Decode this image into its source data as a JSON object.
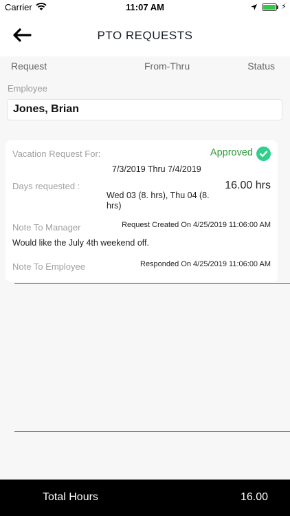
{
  "status_bar": {
    "carrier": "Carrier",
    "time": "11:07 AM",
    "icons": [
      "wifi-icon",
      "location-arrow-icon",
      "battery-icon",
      "charging-bolt-icon"
    ],
    "battery_color": "#33c84a"
  },
  "nav": {
    "title": "PTO REQUESTS",
    "back_icon": "arrow-left-icon"
  },
  "columns": {
    "request": "Request",
    "from_thru": "From-Thru",
    "status": "Status"
  },
  "employee": {
    "label": "Employee",
    "name": "Jones, Brian"
  },
  "request_card": {
    "vacation_label": "Vacation Request For:",
    "status": "Approved",
    "status_color": "#2e9a3c",
    "check_color": "#2fcf8c",
    "date_range": "7/3/2019 Thru 7/4/2019",
    "days_label": "Days requested :",
    "days_detail": "Wed 03 (8. hrs), Thu 04 (8. hrs)",
    "hours": "16.00 hrs",
    "note_manager_label": "Note To Manager",
    "request_created": "Request Created On 4/25/2019 11:06:00 AM",
    "note_manager_text": "Would like the July 4th weekend off.",
    "note_employee_label": "Note To Employee",
    "responded": "Responded On 4/25/2019 11:06:00 AM"
  },
  "footer": {
    "total_label": "Total Hours",
    "total_value": "16.00"
  }
}
